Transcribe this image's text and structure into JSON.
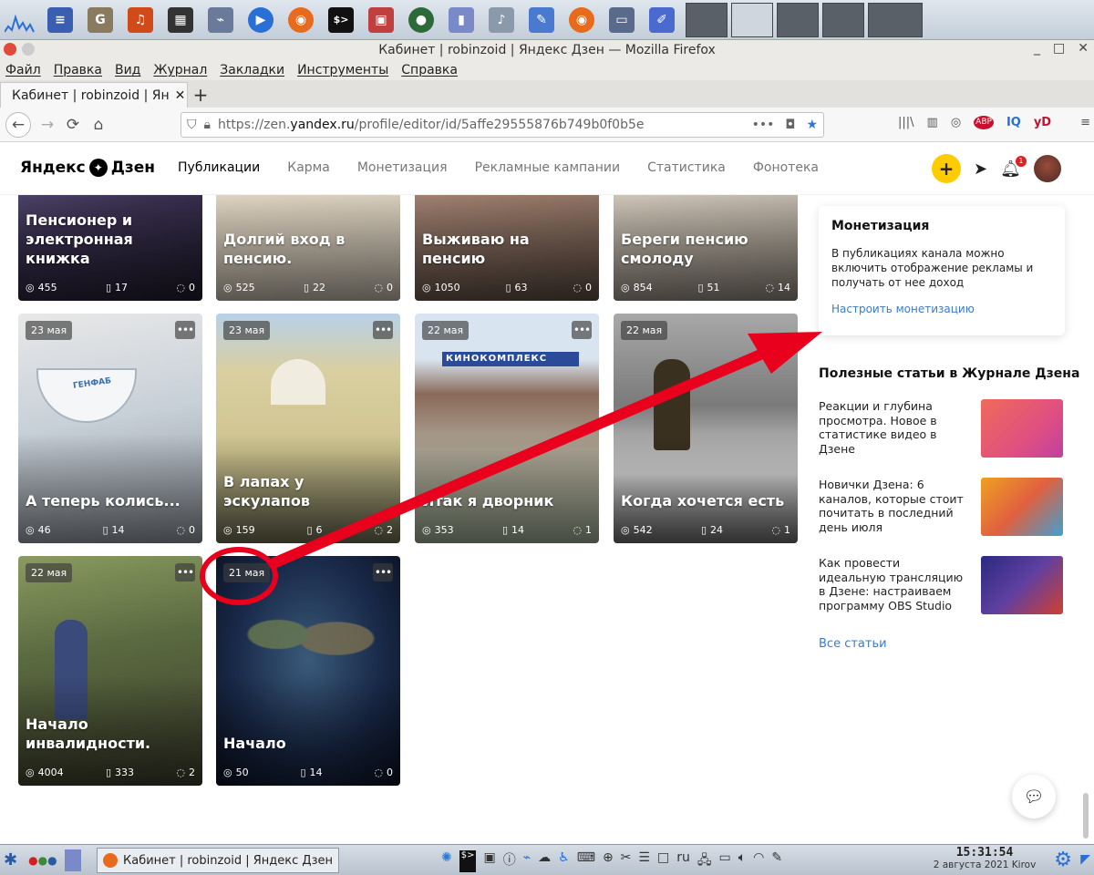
{
  "window": {
    "title": "Кабинет | robinzoid | Яндекс Дзен — Mozilla Firefox"
  },
  "menu": [
    "Файл",
    "Правка",
    "Вид",
    "Журнал",
    "Закладки",
    "Инструменты",
    "Справка"
  ],
  "tab": {
    "label": "Кабинет | robinzoid | Ян"
  },
  "url": {
    "prefix": "https://zen.",
    "host": "yandex.ru",
    "path": "/profile/editor/id/5affe29555876b749b0f0b5e",
    "more": "•••"
  },
  "extensions": [
    "ABP",
    "IQ",
    "yD"
  ],
  "logo": {
    "text": "Яндекс",
    "suffix": "Дзен"
  },
  "nav": [
    "Публикации",
    "Карма",
    "Монетизация",
    "Рекламные кампании",
    "Статистика",
    "Фонотека"
  ],
  "notifications": {
    "count": "1"
  },
  "cards": [
    {
      "title": "Пенсионер и электронная книжка",
      "date": "",
      "views": "455",
      "reads": "17",
      "comments": "0"
    },
    {
      "title": "Долгий вход в пенсию.",
      "date": "",
      "views": "525",
      "reads": "22",
      "comments": "0"
    },
    {
      "title": "Выживаю на пенсию",
      "date": "",
      "views": "1050",
      "reads": "63",
      "comments": "0"
    },
    {
      "title": "Береги пенсию смолоду",
      "date": "",
      "views": "854",
      "reads": "51",
      "comments": "14"
    },
    {
      "title": "А теперь колись...",
      "date": "23 мая",
      "views": "46",
      "reads": "14",
      "comments": "0"
    },
    {
      "title": "В лапах у эскулапов",
      "date": "23 мая",
      "views": "159",
      "reads": "6",
      "comments": "2"
    },
    {
      "title": "Итак я дворник",
      "date": "22 мая",
      "views": "353",
      "reads": "14",
      "comments": "1"
    },
    {
      "title": "Когда хочется есть",
      "date": "22 мая",
      "views": "542",
      "reads": "24",
      "comments": "1"
    },
    {
      "title": "Начало инвалидности.",
      "date": "22 мая",
      "views": "4004",
      "reads": "333",
      "comments": "2"
    },
    {
      "title": "Начало",
      "date": "21 мая",
      "views": "50",
      "reads": "14",
      "comments": "0"
    }
  ],
  "image_texts": {
    "cinema": "КИНОКОМПЛЕКС",
    "cup": "ГЕНФАБ"
  },
  "monetization": {
    "title": "Монетизация",
    "text": "В публикациях канала можно включить отображение рекламы и получать от нее доход",
    "link": "Настроить монетизацию"
  },
  "journal": {
    "title": "Полезные статьи в Журнале Дзена",
    "articles": [
      "Реакции и глубина просмотра. Новое в статистике видео в Дзене",
      "Новички Дзена: 6 каналов, которые стоит почитать в последний день июля",
      "Как провести идеальную трансляцию в Дзене: настраиваем программу OBS Studio"
    ],
    "all_link": "Все статьи"
  },
  "taskbar": {
    "task": "Кабинет | robinzoid | Яндекс Дзен",
    "lang": "ru"
  },
  "clock": {
    "time": "15:31:54",
    "date": "2 августа 2021 Kirov"
  },
  "colors": {
    "accent": "#ffcc00",
    "link": "#3a7bc8",
    "annotation": "#e8001c"
  }
}
